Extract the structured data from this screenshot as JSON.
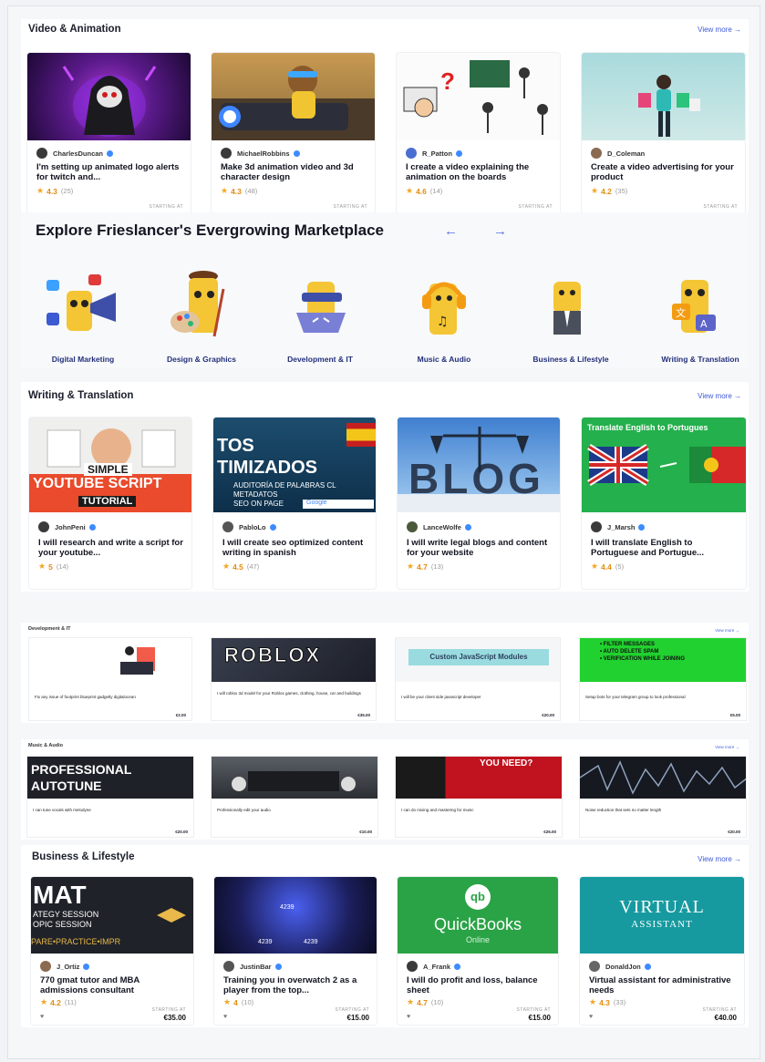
{
  "video_section": {
    "title": "Video & Animation",
    "view_more": "View more →",
    "cards": [
      {
        "seller": "CharlesDuncan",
        "title": "I'm setting up animated logo alerts for twitch and...",
        "rating": "4.3",
        "count": "(25)",
        "starting_at": "STARTING AT"
      },
      {
        "seller": "MichaelRobbins",
        "title": "Make 3d animation video and 3d character design",
        "rating": "4.3",
        "count": "(48)",
        "starting_at": "STARTING AT"
      },
      {
        "seller": "R_Patton",
        "title": "I create a video explaining the animation on the boards",
        "rating": "4.6",
        "count": "(14)",
        "starting_at": "STARTING AT"
      },
      {
        "seller": "D_Coleman",
        "title": "Create a video advertising for your product",
        "rating": "4.2",
        "count": "(35)",
        "starting_at": "STARTING AT"
      }
    ]
  },
  "explore": {
    "title": "Explore Frieslancer's Evergrowing Marketplace",
    "prev": "←",
    "next": "→",
    "categories": [
      {
        "label": "Digital Marketing"
      },
      {
        "label": "Design & Graphics"
      },
      {
        "label": "Development & IT"
      },
      {
        "label": "Music & Audio"
      },
      {
        "label": "Business & Lifestyle"
      },
      {
        "label": "Writing & Translation"
      }
    ]
  },
  "writing_section": {
    "title": "Writing & Translation",
    "view_more": "View more →",
    "cards": [
      {
        "seller": "JohnPeni",
        "title": "I will research and write a script for your youtube...",
        "rating": "5",
        "count": "(14)",
        "thumb_text": [
          "SIMPLE",
          "YOUTUBE SCRIPT",
          "TUTORIAL"
        ]
      },
      {
        "seller": "PabloLo",
        "title": "I will create seo optimized content writing in spanish",
        "rating": "4.5",
        "count": "(47)",
        "thumb_text": [
          "TOS",
          "TIMIZADOS",
          "AUDITORÍA DE PALABRAS CL",
          "METADATOS",
          "SEO ON PAGE",
          "Google"
        ]
      },
      {
        "seller": "LanceWolfe",
        "title": "I will write legal blogs and content for your website",
        "rating": "4.7",
        "count": "(13)",
        "thumb_text": [
          "BLOG"
        ]
      },
      {
        "seller": "J_Marsh",
        "title": "I will translate English to Portuguese and Portugue...",
        "rating": "4.4",
        "count": "(5)",
        "thumb_text": [
          "Translate English to Portugues"
        ]
      }
    ]
  },
  "dev_section": {
    "title": "Development & IT",
    "view_more": "View more →",
    "cards": [
      {
        "title": "Fix any issue of footprint blueprint gadgetly digitalocean",
        "price": "€2.00"
      },
      {
        "title": "I will roblox 3d model for your Roblox games, clothing, house, car and buildings",
        "price": "€35.00",
        "thumb_text": "ROBLOX"
      },
      {
        "title": "I will be your client side javascript developer",
        "price": "€20.00",
        "thumb_text": "Custom JavaScript Modules"
      },
      {
        "title": "Setup bots for your telegram group to look professional",
        "price": "€5.00",
        "thumb_text": [
          "• FILTER MESSAGES",
          "• AUTO DELETE SPAM",
          "• VERIFICATION WHILE JOINING"
        ]
      }
    ]
  },
  "music_section": {
    "title": "Music & Audio",
    "view_more": "View more →",
    "cards": [
      {
        "title": "I can tune vocals with melodyne",
        "price": "€20.00",
        "thumb_text": [
          "PROFESSIONAL",
          "AUTOTUNE"
        ]
      },
      {
        "title": "Professionally edit your audio",
        "price": "€10.00"
      },
      {
        "title": "I can do mixing and mastering for music",
        "price": "€25.00",
        "thumb_text": "YOU NEED?"
      },
      {
        "title": "Noise reduction that sets no matter length",
        "price": "€20.00"
      }
    ]
  },
  "business_section": {
    "title": "Business & Lifestyle",
    "view_more": "View more →",
    "cards": [
      {
        "seller": "J_Ortiz",
        "title": "770 gmat tutor and MBA admissions consultant",
        "rating": "4.2",
        "count": "(11)",
        "starting_at": "STARTING AT",
        "price": "€35.00",
        "thumb_text": [
          "MAT",
          "ATEGY SESSION",
          "OPIC SESSION",
          "PARE•PRACTICE•IMPR"
        ]
      },
      {
        "seller": "JustinBar",
        "title": "Training you in overwatch 2 as a player from the top...",
        "rating": "4",
        "count": "(10)",
        "starting_at": "STARTING AT",
        "price": "€15.00",
        "thumb_text": [
          "4239",
          "4239",
          "4239"
        ]
      },
      {
        "seller": "A_Frank",
        "title": "I will do profit and loss, balance sheet",
        "rating": "4.7",
        "count": "(10)",
        "starting_at": "STARTING AT",
        "price": "€15.00",
        "thumb_text": [
          "qb",
          "QuickBooks",
          "Online"
        ]
      },
      {
        "seller": "DonaldJon",
        "title": "Virtual assistant for administrative needs",
        "rating": "4.3",
        "count": "(33)",
        "starting_at": "STARTING AT",
        "price": "€40.00",
        "thumb_text": [
          "VIRTUAL",
          "ASSISTANT"
        ]
      }
    ]
  },
  "colors": {
    "accent": "#3d58d6",
    "star": "#f5a623",
    "green": "#1ca84e",
    "navy": "#233079"
  }
}
